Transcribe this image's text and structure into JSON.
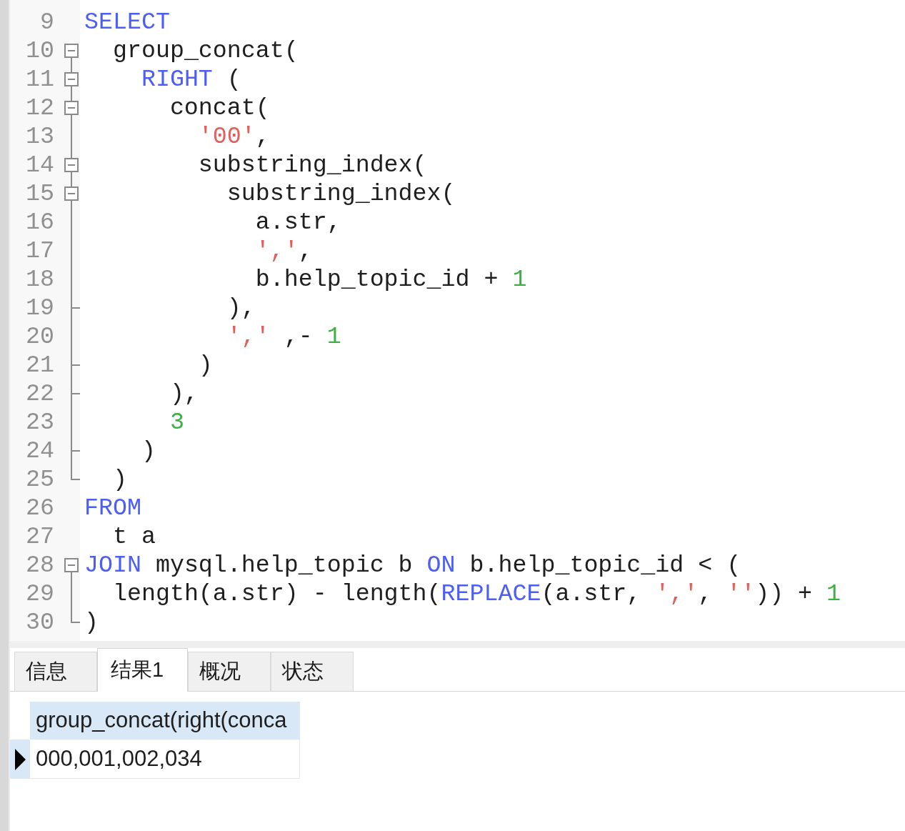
{
  "editor": {
    "lines": [
      {
        "number": "9",
        "kind": "line",
        "tokens": [
          {
            "kind": "keyword",
            "text": "SELECT"
          }
        ]
      },
      {
        "number": "10",
        "kind": "open",
        "expanded": true,
        "tokens": [
          {
            "kind": "plain",
            "text": "  group_concat("
          }
        ]
      },
      {
        "number": "11",
        "kind": "open",
        "expanded": true,
        "tokens": [
          {
            "kind": "keyword",
            "text": "    RIGHT"
          },
          {
            "kind": "plain",
            "text": " ("
          }
        ]
      },
      {
        "number": "12",
        "kind": "open",
        "expanded": true,
        "tokens": [
          {
            "kind": "plain",
            "text": "      concat("
          }
        ]
      },
      {
        "number": "13",
        "kind": "line",
        "tokens": [
          {
            "kind": "string",
            "text": "        '00'"
          },
          {
            "kind": "plain",
            "text": ","
          }
        ]
      },
      {
        "number": "14",
        "kind": "open",
        "expanded": true,
        "tokens": [
          {
            "kind": "plain",
            "text": "        substring_index("
          }
        ]
      },
      {
        "number": "15",
        "kind": "open",
        "expanded": true,
        "tokens": [
          {
            "kind": "plain",
            "text": "          substring_index("
          }
        ]
      },
      {
        "number": "16",
        "kind": "line",
        "tokens": [
          {
            "kind": "plain",
            "text": "            a.str,"
          }
        ]
      },
      {
        "number": "17",
        "kind": "line",
        "tokens": [
          {
            "kind": "string",
            "text": "            ','"
          },
          {
            "kind": "plain",
            "text": ","
          }
        ]
      },
      {
        "number": "18",
        "kind": "line",
        "tokens": [
          {
            "kind": "plain",
            "text": "            b.help_topic_id + "
          },
          {
            "kind": "number",
            "text": "1"
          }
        ]
      },
      {
        "number": "19",
        "kind": "close",
        "tokens": [
          {
            "kind": "plain",
            "text": "          ),"
          }
        ]
      },
      {
        "number": "20",
        "kind": "line",
        "tokens": [
          {
            "kind": "string",
            "text": "          ','"
          },
          {
            "kind": "plain",
            "text": " ,- "
          },
          {
            "kind": "number",
            "text": "1"
          }
        ]
      },
      {
        "number": "21",
        "kind": "close",
        "tokens": [
          {
            "kind": "plain",
            "text": "        )"
          }
        ]
      },
      {
        "number": "22",
        "kind": "close",
        "tokens": [
          {
            "kind": "plain",
            "text": "      ),"
          }
        ]
      },
      {
        "number": "23",
        "kind": "line",
        "tokens": [
          {
            "kind": "number",
            "text": "      3"
          }
        ]
      },
      {
        "number": "24",
        "kind": "close",
        "tokens": [
          {
            "kind": "plain",
            "text": "    )"
          }
        ]
      },
      {
        "number": "25",
        "kind": "close",
        "tokens": [
          {
            "kind": "plain",
            "text": "  )"
          }
        ]
      },
      {
        "number": "26",
        "kind": "line",
        "tokens": [
          {
            "kind": "keyword",
            "text": "FROM"
          }
        ]
      },
      {
        "number": "27",
        "kind": "line",
        "tokens": [
          {
            "kind": "plain",
            "text": "  t a"
          }
        ]
      },
      {
        "number": "28",
        "kind": "open",
        "expanded": true,
        "tokens": [
          {
            "kind": "keyword",
            "text": "JOIN"
          },
          {
            "kind": "plain",
            "text": " mysql.help_topic b "
          },
          {
            "kind": "keyword",
            "text": "ON"
          },
          {
            "kind": "plain",
            "text": " b.help_topic_id < ("
          }
        ]
      },
      {
        "number": "29",
        "kind": "line",
        "tokens": [
          {
            "kind": "plain",
            "text": "  length(a.str) - length("
          },
          {
            "kind": "keyword",
            "text": "REPLACE"
          },
          {
            "kind": "plain",
            "text": "(a.str, "
          },
          {
            "kind": "string",
            "text": "','"
          },
          {
            "kind": "plain",
            "text": ", "
          },
          {
            "kind": "string",
            "text": "''"
          },
          {
            "kind": "plain",
            "text": ")) + "
          },
          {
            "kind": "number",
            "text": "1"
          }
        ]
      },
      {
        "number": "30",
        "kind": "close",
        "tokens": [
          {
            "kind": "plain",
            "text": ")"
          }
        ]
      }
    ]
  },
  "tabs": [
    {
      "label": "信息",
      "selected": false
    },
    {
      "label": "结果1",
      "selected": true
    },
    {
      "label": "概况",
      "selected": false
    },
    {
      "label": "状态",
      "selected": false
    }
  ],
  "result_grid": {
    "columns": [
      "group_concat(right(conca"
    ],
    "rows": [
      {
        "selected": true,
        "cells": [
          "000,001,002,034"
        ]
      }
    ]
  }
}
